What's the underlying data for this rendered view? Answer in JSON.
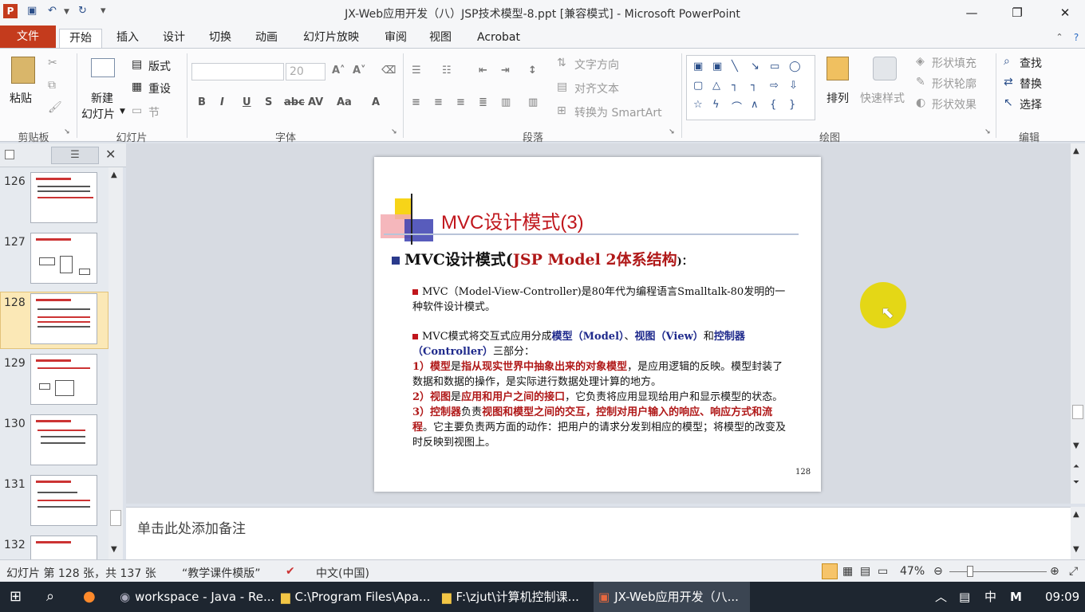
{
  "window": {
    "title": "JX-Web应用开发（八）JSP技术模型-8.ppt [兼容模式] - Microsoft PowerPoint",
    "min": "—",
    "max": "❐",
    "close": "✕"
  },
  "tabs": [
    "文件",
    "开始",
    "插入",
    "设计",
    "切换",
    "动画",
    "幻灯片放映",
    "审阅",
    "视图",
    "Acrobat"
  ],
  "ribbon": {
    "clipboard": {
      "paste": "粘贴",
      "group": "剪贴板"
    },
    "slides": {
      "new1": "新建",
      "new2": "幻灯片",
      "layout": "版式",
      "reset": "重设",
      "section": "节",
      "group": "幻灯片"
    },
    "font": {
      "size": "20",
      "group": "字体"
    },
    "paragraph": {
      "textdir": "文字方向",
      "align": "对齐文本",
      "smartart": "转换为 SmartArt",
      "group": "段落"
    },
    "drawing": {
      "arrange": "排列",
      "quickstyle": "快速样式",
      "fill": "形状填充",
      "outline": "形状轮廓",
      "effect": "形状效果",
      "group": "绘图"
    },
    "editing": {
      "find": "查找",
      "replace": "替换",
      "select": "选择",
      "group": "编辑"
    }
  },
  "slides": [
    {
      "num": "126"
    },
    {
      "num": "127"
    },
    {
      "num": "128"
    },
    {
      "num": "129"
    },
    {
      "num": "130"
    },
    {
      "num": "131"
    },
    {
      "num": "132"
    }
  ],
  "slide": {
    "title": "MVC设计模式(3)",
    "heading_a": "MVC设计模式(",
    "heading_b": "JSP Model 2体系结构",
    "heading_c": ")：",
    "p1": "MVC（Model-View-Controller)是80年代为编程语言Smalltalk-80发明的一种软件设计模式。",
    "p2a": "MVC模式将交互式应用分成",
    "p2b": "模型（Model）",
    "p2c": "、",
    "p2d": "视图（View）",
    "p2e": "和",
    "p2f": "控制器（Controller）",
    "p2g": "三部分：",
    "l1a": "1）模型",
    "l1b": "是",
    "l1c": "指从现实世界中抽象出来的对象模型",
    "l1d": "，是应用逻辑的反映。模型封装了数据和数据的操作，是实际进行数据处理计算的地方。",
    "l2a": "2）视图",
    "l2b": "是",
    "l2c": "应用和用户之间的接口",
    "l2d": "，它负责将应用显现给用户和显示模型的状态。",
    "l3a": "3）控制器",
    "l3b": "负责",
    "l3c": "视图和模型之间的交互，控制对用户输入的响应、响应方式和流程",
    "l3d": "。它主要负责两方面的动作：把用户的请求分发到相应的模型；将模型的改变及时反映到视图上。",
    "page": "128"
  },
  "notes_placeholder": "单击此处添加备注",
  "status": {
    "slideinfo": "幻灯片 第 128 张，共 137 张",
    "theme": "“教学课件模版”",
    "lang": "中文(中国)",
    "zoom": "47%"
  },
  "taskbar": {
    "items": [
      "workspace - Java - Re...",
      "C:\\Program Files\\Apa...",
      "F:\\zjut\\计算机控制课...",
      "JX-Web应用开发（八..."
    ],
    "ime": "中",
    "ime2": "M",
    "time": "09:09"
  },
  "colors": {
    "accent": "#c43b1d",
    "slide_title": "#c0161c"
  }
}
